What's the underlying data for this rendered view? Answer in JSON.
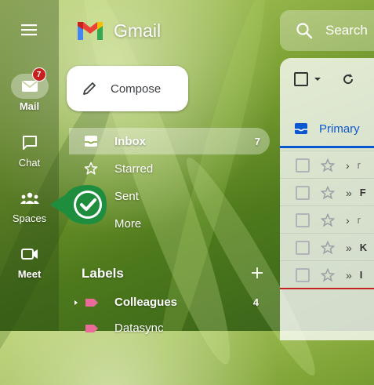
{
  "app": {
    "name": "Gmail"
  },
  "rail": [
    {
      "key": "mail",
      "label": "Mail",
      "badge": "7"
    },
    {
      "key": "chat",
      "label": "Chat"
    },
    {
      "key": "spaces",
      "label": "Spaces"
    },
    {
      "key": "meet",
      "label": "Meet"
    }
  ],
  "compose": {
    "label": "Compose"
  },
  "nav": [
    {
      "label": "Inbox",
      "count": "7"
    },
    {
      "label": "Starred"
    },
    {
      "label": "Sent"
    },
    {
      "label": "More"
    }
  ],
  "labels": {
    "heading": "Labels",
    "items": [
      {
        "name": "Colleagues",
        "count": "4",
        "color": "#e86b9a"
      },
      {
        "name": "Datasync",
        "color": "#e86b9a"
      }
    ]
  },
  "search": {
    "placeholder": "Search"
  },
  "tabs": {
    "primary": "Primary"
  },
  "rows": [
    {
      "important": "›",
      "sender": "r",
      "read": true
    },
    {
      "important": "»",
      "sender": "F",
      "read": false
    },
    {
      "important": "›",
      "sender": "r",
      "read": true
    },
    {
      "important": "»",
      "sender": "K",
      "read": false
    },
    {
      "important": "»",
      "sender": "I",
      "read": false
    }
  ],
  "colors": {
    "accent": "#0b57d0",
    "badge": "#c5221f",
    "tooltip": "#1e8e3e"
  }
}
